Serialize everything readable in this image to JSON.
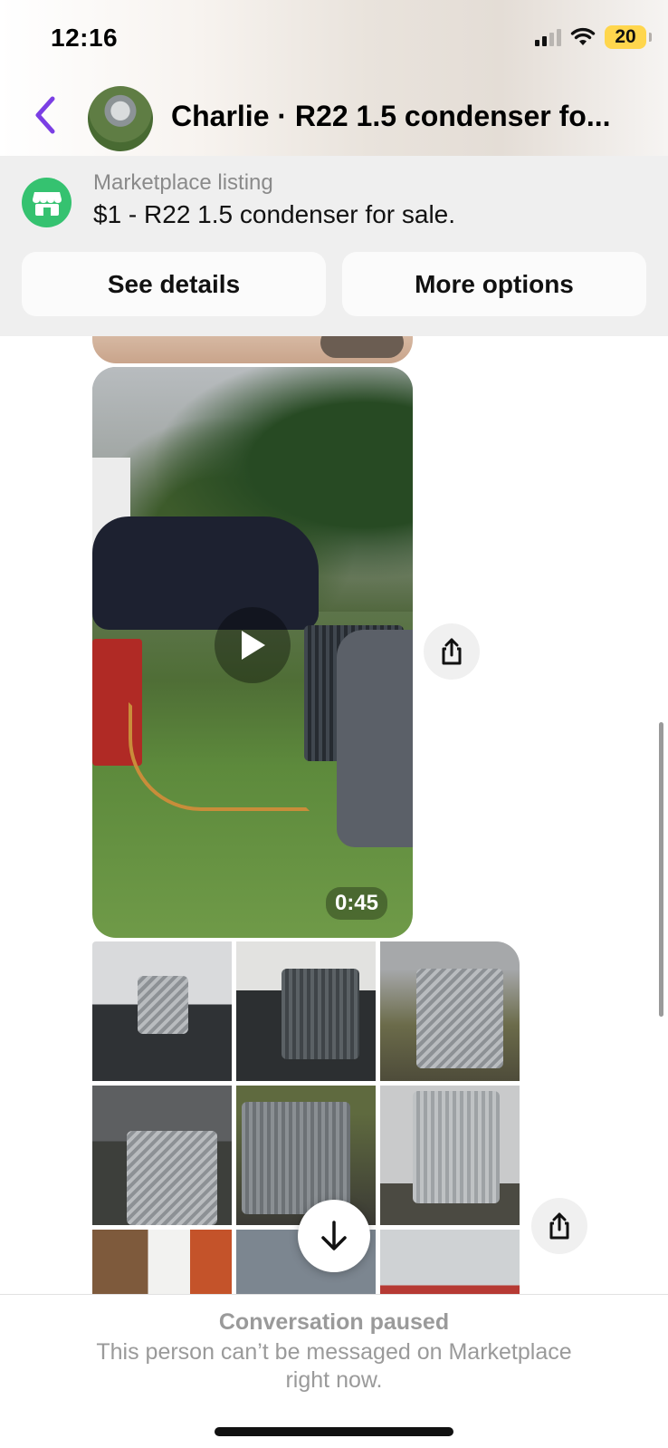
{
  "status_bar": {
    "time": "12:16",
    "battery": "20",
    "battery_color": "#ffd64d",
    "icons": [
      "cellular-signal-icon",
      "wifi-icon",
      "battery-icon"
    ]
  },
  "header": {
    "title": "Charlie · R22 1.5 condenser fo...",
    "accent_color": "#7b3fe4",
    "icons": [
      "chevron-left-icon"
    ]
  },
  "listing": {
    "caption": "Marketplace listing",
    "title": "$1 - R22 1.5 condenser for sale.",
    "icon": "marketplace-shop-icon",
    "icon_color": "#35c270",
    "see_details_label": "See details",
    "more_options_label": "More options"
  },
  "messages": {
    "video": {
      "duration": "0:45",
      "icons": [
        "play-icon",
        "share-icon"
      ]
    },
    "photo_grid": {
      "photo_count_visible": 9,
      "icons": [
        "share-icon",
        "arrow-down-icon"
      ]
    }
  },
  "footer": {
    "paused_title": "Conversation paused",
    "paused_text": "This person can’t be messaged on Marketplace right now."
  }
}
